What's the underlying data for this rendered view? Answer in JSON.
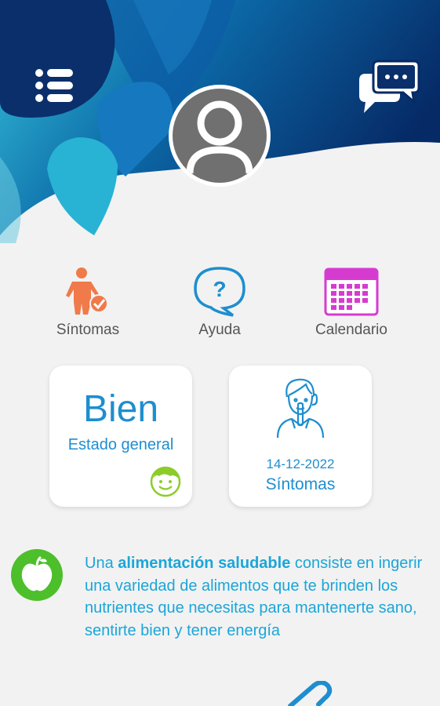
{
  "app": {
    "icons": {
      "menu": "list-menu-icon",
      "chat": "chat-bubbles-icon",
      "avatar": "user-avatar-icon"
    }
  },
  "shortcuts": [
    {
      "label": "Síntomas",
      "icon": "person-check-icon"
    },
    {
      "label": "Ayuda",
      "icon": "help-question-icon"
    },
    {
      "label": "Calendario",
      "icon": "calendar-icon"
    }
  ],
  "estado": {
    "value": "Bien",
    "label": "Estado general",
    "icon": "smiley-face-icon"
  },
  "sintomas_card": {
    "date": "14-12-2022",
    "label": "Síntomas",
    "icon": "doctor-icon"
  },
  "tip": {
    "icon": "apple-icon",
    "prefix": "Una ",
    "highlight": "alimentación saludable",
    "body": " consiste en ingerir una variedad de alimentos que te brinden los nutrientes que necesitas para mantenerte sano, sentirte bien y tener energía"
  },
  "colors": {
    "navy": "#0a2f6b",
    "accent": "#1e8ecf",
    "text_blue": "#1aa6d9",
    "orange": "#f07a4a",
    "magenta": "#d63bd0",
    "green": "#4cbf2a"
  }
}
